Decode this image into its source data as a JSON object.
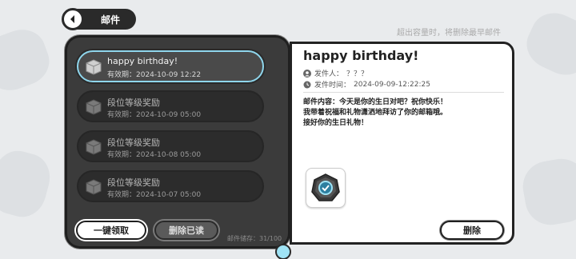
{
  "header": {
    "title": "邮件",
    "back_icon": "back-arrow-icon"
  },
  "notice": "超出容量时，将删除最早邮件",
  "mail_list": {
    "items": [
      {
        "title": "happy  birthday!",
        "date": "有效期：2024-10-09  12:22",
        "selected": true
      },
      {
        "title": "段位等级奖励",
        "date": "有效期：2024-10-09  05:00",
        "selected": false
      },
      {
        "title": "段位等级奖励",
        "date": "有效期：2024-10-08  05:00",
        "selected": false
      },
      {
        "title": "段位等级奖励",
        "date": "有效期：2024-10-07  05:00",
        "selected": false
      }
    ]
  },
  "actions": {
    "claim_all": "一键领取",
    "delete_read": "删除已读",
    "storage": "邮件储存：31/100"
  },
  "detail": {
    "title": "happy  birthday!",
    "sender_label": "发件人：",
    "sender_value": "？？？",
    "time_label": "发件时间：",
    "time_value": "2024-09-09-12:22:25",
    "content_lines": [
      "邮件内容：今天是你的生日对吧？祝你快乐！",
      "我带着祝福和礼物潇洒地拜访了你的邮箱哦。",
      "接好你的生日礼物！"
    ],
    "gift_icon": "gift-item-icon",
    "delete": "删除"
  },
  "colors": {
    "selected_border": "#8fd6ec",
    "panel_dark": "#3b3b3b",
    "background": "#e9ebed"
  }
}
